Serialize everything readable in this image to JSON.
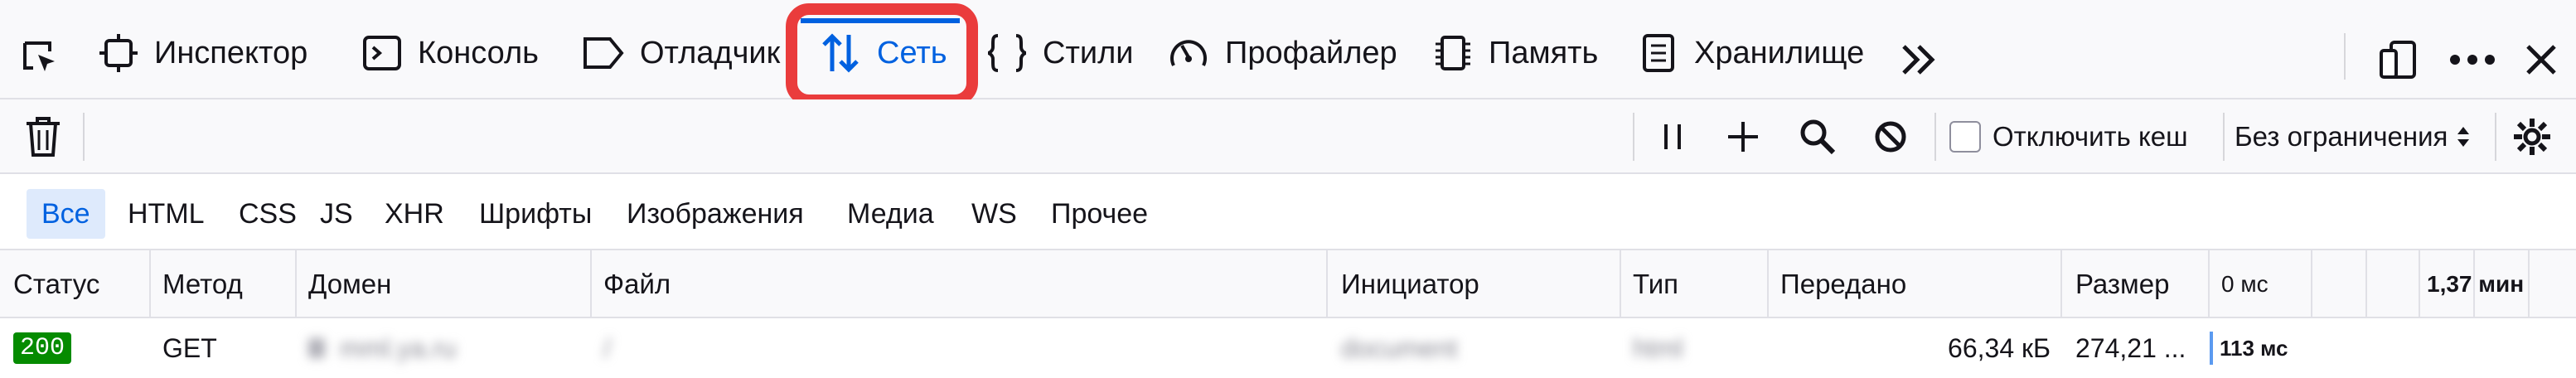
{
  "tabs": [
    {
      "label": "Инспектор"
    },
    {
      "label": "Консоль"
    },
    {
      "label": "Отладчик"
    },
    {
      "label": "Сеть"
    },
    {
      "label": "Стили"
    },
    {
      "label": "Профайлер"
    },
    {
      "label": "Память"
    },
    {
      "label": "Хранилище"
    }
  ],
  "selected_tab": "Сеть",
  "toolbar": {
    "search_placeholder": "Поиск URL",
    "disable_cache_label": "Отключить кеш",
    "throttling_value": "Без ограничения"
  },
  "filters": [
    "Все",
    "HTML",
    "CSS",
    "JS",
    "XHR",
    "Шрифты",
    "Изображения",
    "Медиа",
    "WS",
    "Прочее"
  ],
  "active_filter": "Все",
  "columns": [
    "Статус",
    "Метод",
    "Домен",
    "Файл",
    "Инициатор",
    "Тип",
    "Передано",
    "Размер"
  ],
  "timeline": {
    "start": "0 мс",
    "end": "1,37 мин"
  },
  "rows": [
    {
      "status": "200",
      "method": "GET",
      "domain": "mml.ya.ru",
      "file": "/",
      "initiator": "document",
      "type": "html",
      "transferred": "66,34 кБ",
      "size": "274,21 ...",
      "timing": "113 мс"
    }
  ],
  "colors": {
    "accent": "#0061e0",
    "highlight": "#ea3c3c",
    "status_ok": "#058b00"
  }
}
